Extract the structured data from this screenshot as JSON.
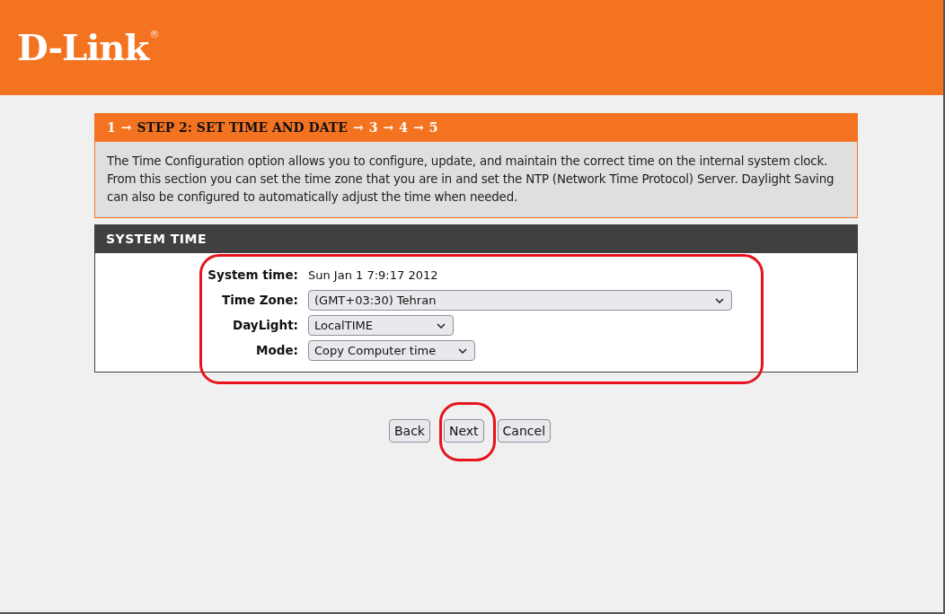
{
  "header": {
    "logo": "D-Link",
    "registered_mark": "®"
  },
  "wizard": {
    "separator": "→",
    "steps": [
      {
        "label": "1",
        "selected": false
      },
      {
        "label": "STEP 2: SET TIME AND DATE",
        "selected": true
      },
      {
        "label": "3",
        "selected": false
      },
      {
        "label": "4",
        "selected": false
      },
      {
        "label": "5",
        "selected": false
      }
    ],
    "description": "The Time Configuration option allows you to configure, update, and maintain the correct time on the internal system clock. From this section you can set the time zone that you are in and set the NTP (Network Time Protocol) Server. Daylight Saving can also be configured to automatically adjust the time when needed."
  },
  "system_time": {
    "title": "SYSTEM TIME",
    "fields": [
      {
        "kind": "text",
        "label": "System time:",
        "value": "Sun Jan 1 7:9:17 2012"
      },
      {
        "kind": "select",
        "label": "Time Zone:",
        "value": "(GMT+03:30) Tehran"
      },
      {
        "kind": "select",
        "label": "DayLight:",
        "value": "LocalTIME"
      },
      {
        "kind": "select",
        "label": "Mode:",
        "value": "Copy Computer time"
      }
    ]
  },
  "buttons": [
    "Back",
    "Next",
    "Cancel"
  ]
}
